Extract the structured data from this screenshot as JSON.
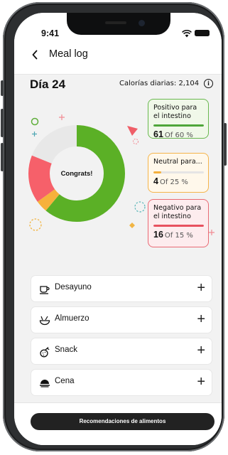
{
  "status_bar": {
    "time": "9:41"
  },
  "header": {
    "back_icon": "chevron-left-icon",
    "title": "Meal log"
  },
  "summary": {
    "day": "Día 24",
    "calories": "Calorías diarias: 2,104",
    "info_icon": "info-icon"
  },
  "chart_data": {
    "type": "pie",
    "center_label": "Congrats!",
    "slices": [
      {
        "label": "Positivo para el intestino",
        "value": 61,
        "color": "#5bb026"
      },
      {
        "label": "Neutral para...",
        "value": 4,
        "color": "#f6b13b"
      },
      {
        "label": "Negativo para el intestino",
        "value": 16,
        "color": "#f6606a"
      },
      {
        "label": "",
        "value": 19,
        "color": "#e8e8e8"
      }
    ]
  },
  "legend": [
    {
      "title_line1": "Positivo para",
      "title_line2": "el intestino",
      "value": "61",
      "of_text": "Of 60 %",
      "progress": 1.0,
      "color": "#4fa63a"
    },
    {
      "title_line1": "Neutral para...",
      "title_line2": "",
      "value": "4",
      "of_text": "Of 25 %",
      "progress": 0.16,
      "color": "#f5b03c"
    },
    {
      "title_line1": "Negativo para",
      "title_line2": "el intestino",
      "value": "16",
      "of_text": "Of 15 %",
      "progress": 1.0,
      "color": "#e8515f"
    }
  ],
  "meals": [
    {
      "label": "Desayuno",
      "icon": "coffee-cup-icon"
    },
    {
      "label": "Almuerzo",
      "icon": "bowl-icon"
    },
    {
      "label": "Snack",
      "icon": "fruit-icon"
    },
    {
      "label": "Cena",
      "icon": "dish-icon"
    }
  ],
  "cta": {
    "label": "Recomendaciones de alimentos"
  }
}
